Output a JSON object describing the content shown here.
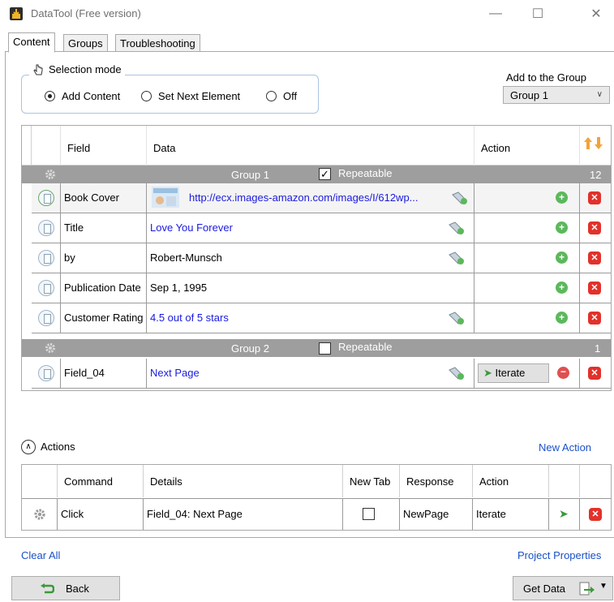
{
  "window": {
    "title": "DataTool (Free version)",
    "minimize": "—",
    "maximize": "☐",
    "close": "✕"
  },
  "tabs": [
    "Content",
    "Groups",
    "Troubleshooting"
  ],
  "selection_mode": {
    "title": "Selection mode",
    "options": [
      "Add Content",
      "Set Next Element",
      "Off"
    ],
    "selected": "Add Content"
  },
  "add_to_group": {
    "label": "Add to the Group",
    "value": "Group 1"
  },
  "grid": {
    "columns": [
      "Field",
      "Data",
      "Action"
    ],
    "groups": [
      {
        "name": "Group 1",
        "repeatable_label": "Repeatable",
        "repeatable": true,
        "count": "12",
        "rows": [
          {
            "field": "Book Cover",
            "data": "http://ecx.images-amazon.com/images/I/612wp..."
          },
          {
            "field": "Title",
            "data": "Love You Forever"
          },
          {
            "field": "by",
            "data": "Robert-Munsch"
          },
          {
            "field": "Publication Date",
            "data": "Sep 1, 1995"
          },
          {
            "field": "Customer Rating",
            "data": "4.5 out of 5 stars"
          }
        ]
      },
      {
        "name": "Group 2",
        "repeatable_label": "Repeatable",
        "repeatable": false,
        "count": "1",
        "rows": [
          {
            "field": "Field_04",
            "data": "Next Page",
            "action": "Iterate"
          }
        ]
      }
    ]
  },
  "actions": {
    "title": "Actions",
    "new_action": "New Action",
    "columns": [
      "Command",
      "Details",
      "New Tab",
      "Response",
      "Action"
    ],
    "rows": [
      {
        "command": "Click",
        "details": "Field_04: Next Page",
        "new_tab": false,
        "response": "NewPage",
        "action": "Iterate"
      }
    ]
  },
  "footer": {
    "clear_all": "Clear All",
    "project_properties": "Project Properties",
    "back": "Back",
    "get_data": "Get Data"
  },
  "colors": {
    "group_bar": "#9e9e9e",
    "link": "#1a1ae0",
    "add": "#5cb85c",
    "delete": "#e2312a"
  }
}
